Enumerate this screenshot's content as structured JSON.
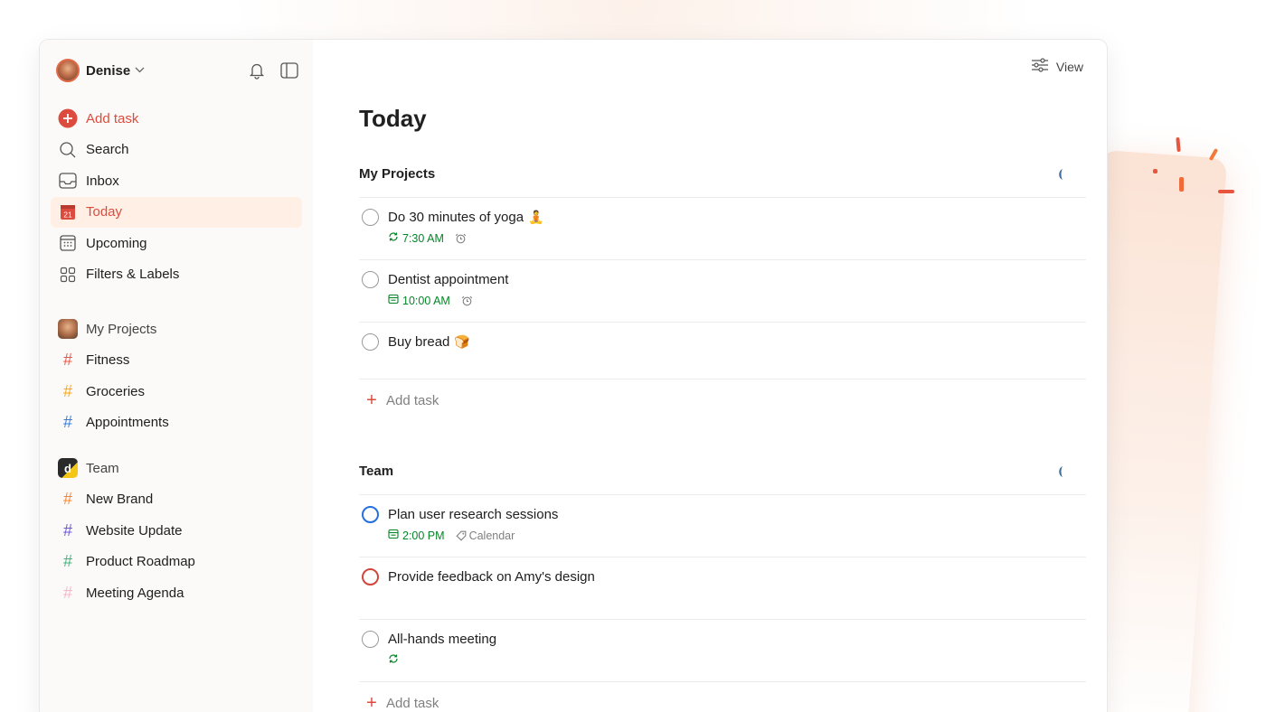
{
  "user": {
    "name": "Denise"
  },
  "sidebar": {
    "nav": [
      {
        "label": "Add task",
        "icon": "plus-circle-icon"
      },
      {
        "label": "Search",
        "icon": "search-icon"
      },
      {
        "label": "Inbox",
        "icon": "inbox-icon"
      },
      {
        "label": "Today",
        "icon": "calendar-today-icon",
        "day": "21"
      },
      {
        "label": "Upcoming",
        "icon": "calendar-grid-icon"
      },
      {
        "label": "Filters & Labels",
        "icon": "filters-icon"
      }
    ],
    "groups": [
      {
        "label": "My Projects",
        "projects": [
          {
            "label": "Fitness",
            "color": "#e05a4e"
          },
          {
            "label": "Groceries",
            "color": "#f5a623"
          },
          {
            "label": "Appointments",
            "color": "#3a7bd5"
          }
        ]
      },
      {
        "label": "Team",
        "badge": "d",
        "projects": [
          {
            "label": "New Brand",
            "color": "#f08a3c"
          },
          {
            "label": "Website Update",
            "color": "#6a5acd"
          },
          {
            "label": "Product Roadmap",
            "color": "#4caf7d"
          },
          {
            "label": "Meeting Agenda",
            "color": "#f2b8c6"
          }
        ]
      }
    ]
  },
  "main": {
    "view_label": "View",
    "title": "Today",
    "add_task_label": "Add task",
    "sections": [
      {
        "title": "My Projects",
        "tasks": [
          {
            "title": "Do 30 minutes of yoga",
            "emoji": "🧘",
            "time": "7:30 AM",
            "time_icon": "recurring-icon",
            "alarm": true
          },
          {
            "title": "Dentist appointment",
            "time": "10:00 AM",
            "time_icon": "calendar-icon",
            "alarm": true
          },
          {
            "title": "Buy bread",
            "emoji": "🍞"
          }
        ]
      },
      {
        "title": "Team",
        "tasks": [
          {
            "title": "Plan user research sessions",
            "time": "2:00 PM",
            "time_icon": "calendar-icon",
            "label": "Calendar",
            "priority_color": "#246fe0"
          },
          {
            "title": "Provide feedback on Amy's design",
            "priority_color": "#d1453b"
          },
          {
            "title": "All-hands meeting",
            "time_icon": "recurring-icon"
          }
        ]
      }
    ]
  },
  "colors": {
    "accent": "#dc4c3e",
    "due": "#058527",
    "today_bg": "#ffefe5"
  }
}
